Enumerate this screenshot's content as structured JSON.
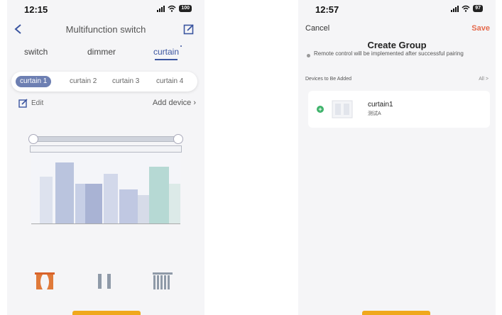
{
  "left_phone": {
    "status": {
      "time": "12:15",
      "battery": "100"
    },
    "header": {
      "title": "Multifunction switch"
    },
    "tabs": [
      {
        "label": "switch",
        "active": false
      },
      {
        "label": "dimmer",
        "active": false
      },
      {
        "label": "curtain",
        "active": true
      }
    ],
    "curtains": [
      {
        "label": "curtain 1",
        "active": true
      },
      {
        "label": "curtain 2",
        "active": false
      },
      {
        "label": "curtain 3",
        "active": false
      },
      {
        "label": "curtain 4",
        "active": false
      }
    ],
    "edit_label": "Edit",
    "add_device_label": "Add device",
    "controls": [
      "open-curtain-icon",
      "pause-icon",
      "close-curtain-icon"
    ],
    "accent_color": "#3b55a0"
  },
  "right_phone": {
    "status": {
      "time": "12:57",
      "battery": "97"
    },
    "cancel_label": "Cancel",
    "save_label": "Save",
    "title": "Create Group",
    "note": "Remote control will be implemented after successful pairing",
    "section_label": "Devices to Be Added",
    "all_label": "All >",
    "device": {
      "name": "curtain1",
      "sub": "测试A"
    },
    "save_color": "#e56a4d",
    "add_color": "#3fb36b"
  }
}
